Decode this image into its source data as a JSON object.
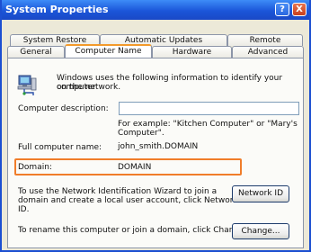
{
  "window": {
    "title": "System Properties"
  },
  "titlebar": {
    "help": "?",
    "close": "X"
  },
  "tabs_row1": [
    {
      "label": "System Restore"
    },
    {
      "label": "Automatic Updates"
    },
    {
      "label": "Remote"
    }
  ],
  "tabs_row2": [
    {
      "label": "General"
    },
    {
      "label": "Computer Name",
      "active": true
    },
    {
      "label": "Hardware"
    },
    {
      "label": "Advanced"
    }
  ],
  "panel": {
    "intro": [
      "Windows uses the following information to identify your computer",
      "on the network."
    ],
    "description_label": "Computer description:",
    "description_value": "",
    "example": [
      "For example: \"Kitchen Computer\" or \"Mary's",
      "Computer\"."
    ],
    "full_name_label": "Full computer name:",
    "full_name_value": "john_smith.DOMAIN",
    "domain_label": "Domain:",
    "domain_value": "DOMAIN",
    "network_id_text": [
      "To use the Network Identification Wizard to join a",
      "domain and create a local user account, click Network",
      "ID."
    ],
    "network_id_button": "Network ID",
    "rename_text": "To rename this computer or join a domain, click Change.",
    "change_button": "Change..."
  },
  "colors": {
    "highlight": "#f07d2a",
    "titlebar": "#1b56d9",
    "active_tab_accent": "#f39a2b"
  },
  "icons": {
    "computer": "computer-network-icon"
  }
}
